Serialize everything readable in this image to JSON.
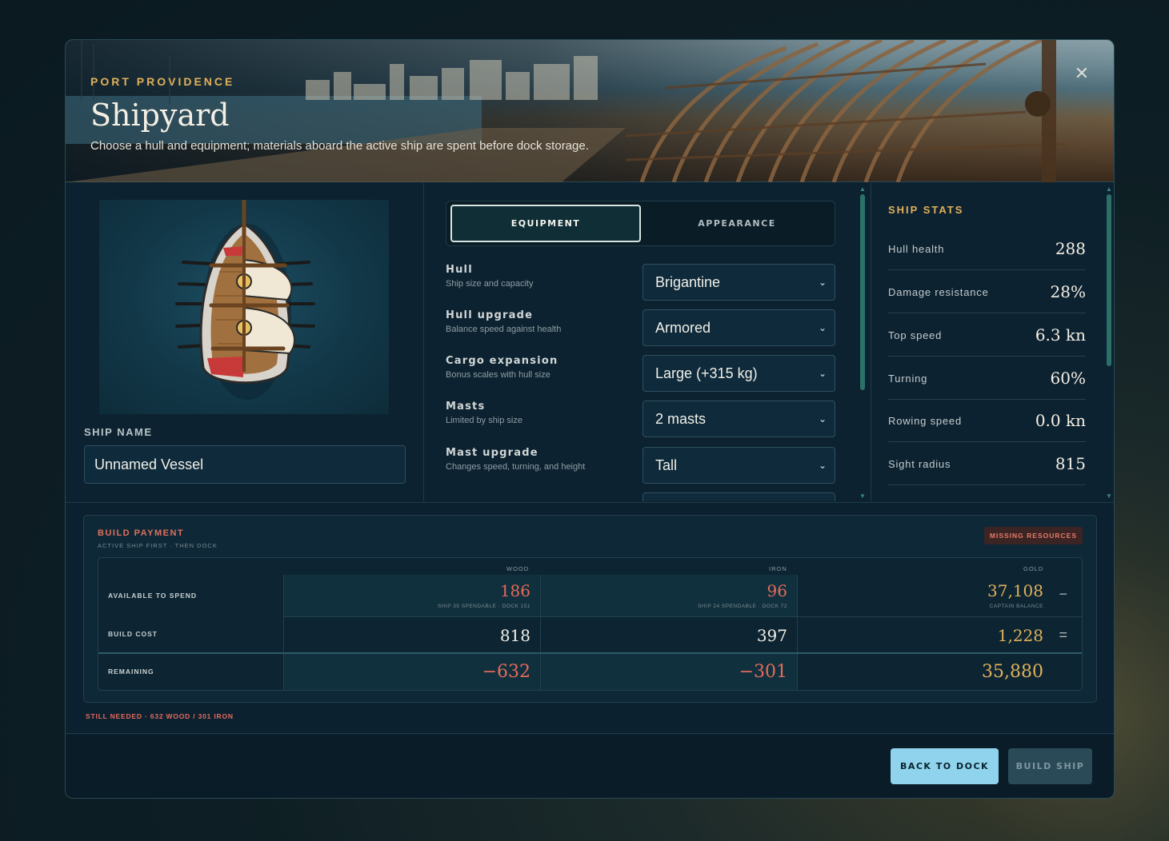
{
  "header": {
    "port_name": "PORT PROVIDENCE",
    "title": "Shipyard",
    "subtitle": "Choose a hull and equipment; materials aboard the active ship are spent before dock storage.",
    "close_label": "✕"
  },
  "left": {
    "ship_name_label": "SHIP NAME",
    "ship_name_value": "Unnamed Vessel"
  },
  "tabs": [
    {
      "label": "EQUIPMENT",
      "active": true
    },
    {
      "label": "APPEARANCE",
      "active": false
    }
  ],
  "fields": [
    {
      "label": "Hull",
      "help": "Ship size and capacity",
      "value": "Brigantine"
    },
    {
      "label": "Hull upgrade",
      "help": "Balance speed against health",
      "value": "Armored"
    },
    {
      "label": "Cargo expansion",
      "help": "Bonus scales with hull size",
      "value": "Large (+315 kg)"
    },
    {
      "label": "Masts",
      "help": "Limited by ship size",
      "value": "2 masts"
    },
    {
      "label": "Mast upgrade",
      "help": "Changes speed, turning, and height",
      "value": "Tall"
    }
  ],
  "stats": {
    "title": "SHIP STATS",
    "rows": [
      {
        "label": "Hull health",
        "value": "288"
      },
      {
        "label": "Damage resistance",
        "value": "28%"
      },
      {
        "label": "Top speed",
        "value": "6.3 kn"
      },
      {
        "label": "Turning",
        "value": "60%"
      },
      {
        "label": "Rowing speed",
        "value": "0.0 kn"
      },
      {
        "label": "Sight radius",
        "value": "815"
      }
    ]
  },
  "payment": {
    "title": "BUILD PAYMENT",
    "subtitle": "ACTIVE SHIP FIRST · THEN DOCK",
    "badge": "MISSING RESOURCES",
    "columns": [
      "WOOD",
      "IRON",
      "GOLD"
    ],
    "rows": {
      "available": {
        "label": "AVAILABLE TO SPEND",
        "wood": "186",
        "wood_note": "SHIP 35 SPENDABLE · DOCK 151",
        "iron": "96",
        "iron_note": "SHIP 24 SPENDABLE · DOCK 72",
        "gold": "37,108",
        "gold_note": "CAPTAIN BALANCE",
        "op": "−"
      },
      "cost": {
        "label": "BUILD COST",
        "wood": "818",
        "iron": "397",
        "gold": "1,228",
        "op": "="
      },
      "remaining": {
        "label": "REMAINING",
        "wood": "−632",
        "iron": "−301",
        "gold": "35,880"
      }
    },
    "still_needed": "STILL NEEDED · 632 WOOD / 301 IRON"
  },
  "footer": {
    "back_label": "BACK TO DOCK",
    "build_label": "BUILD SHIP"
  },
  "colors": {
    "accent_gold": "#e0b05a",
    "alert_red": "#e46a5a",
    "primary_button": "#8fd4ec",
    "panel": "#0d2230"
  }
}
